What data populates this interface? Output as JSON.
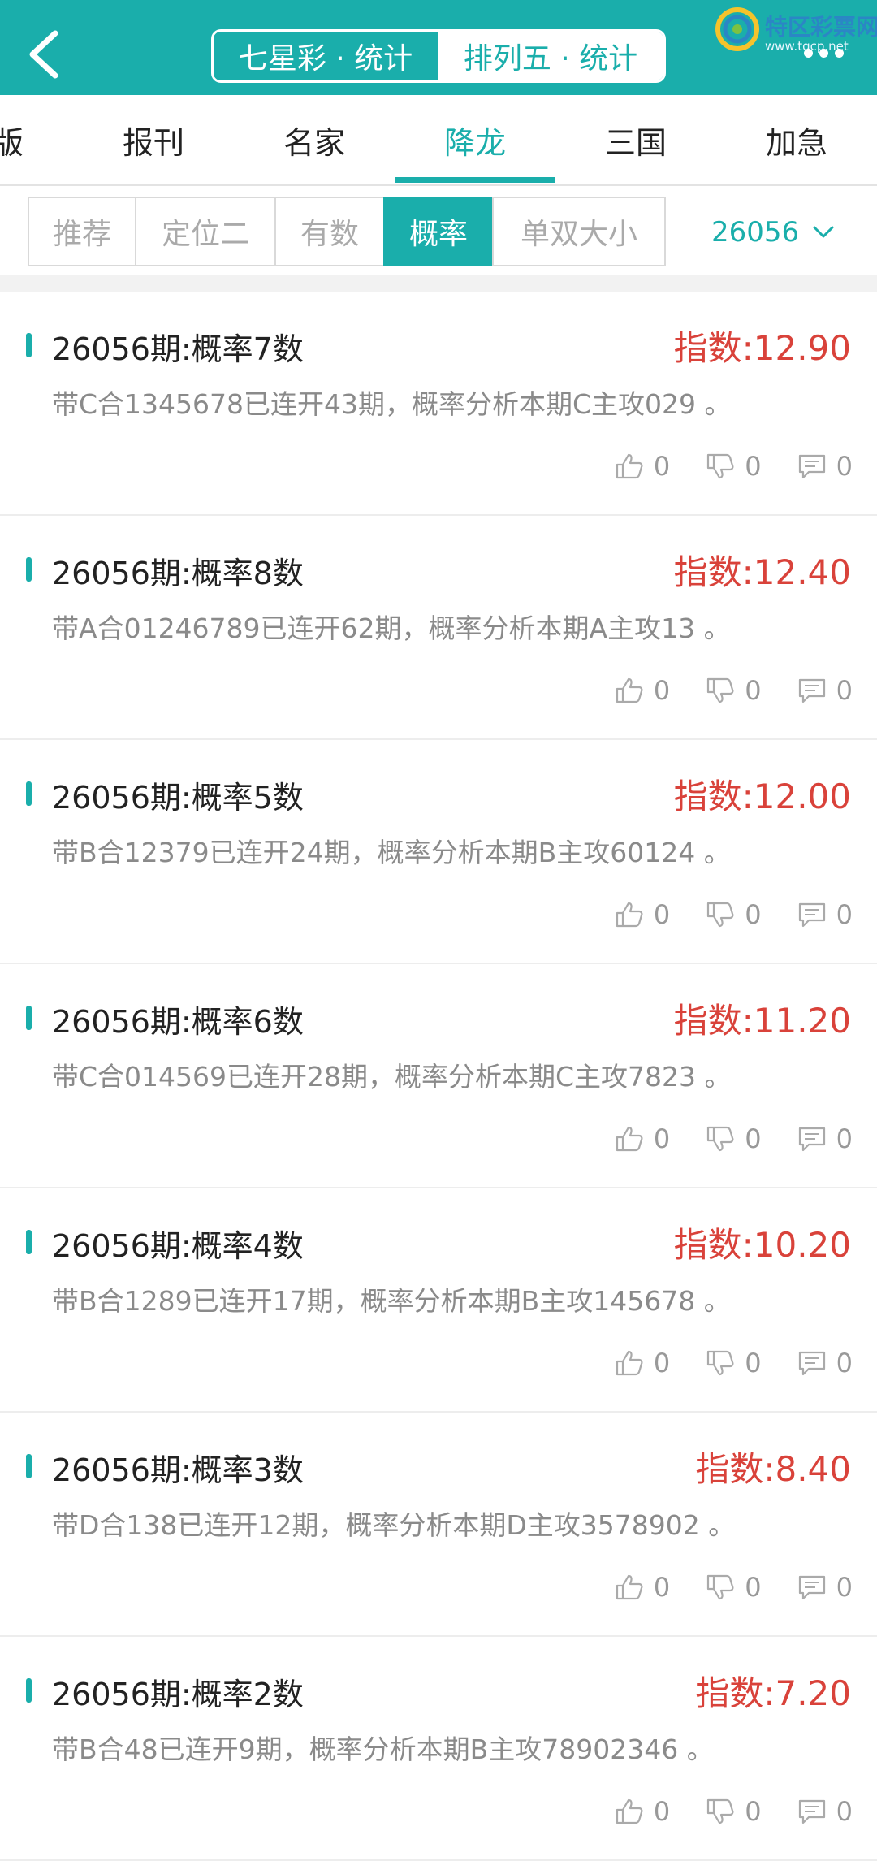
{
  "header": {
    "tab_left": "七星彩 · 统计",
    "tab_right": "排列五 · 统计",
    "logo_name": "特区彩票网",
    "logo_url": "www.tqcp.net",
    "accent": "#1aaeab"
  },
  "categories": [
    "版",
    "报刊",
    "名家",
    "降龙",
    "三国",
    "加急"
  ],
  "active_category": "降龙",
  "filters": [
    "推荐",
    "定位二",
    "有数",
    "概率",
    "单双大小"
  ],
  "active_filter": "概率",
  "issue": "26056",
  "items": [
    {
      "title": "26056期:概率7数",
      "score": "指数:12.90",
      "desc": "带C合1345678已连开43期，概率分析本期C主攻029 。",
      "likes": "0",
      "dislikes": "0",
      "comments": "0"
    },
    {
      "title": "26056期:概率8数",
      "score": "指数:12.40",
      "desc": "带A合01246789已连开62期，概率分析本期A主攻13 。",
      "likes": "0",
      "dislikes": "0",
      "comments": "0"
    },
    {
      "title": "26056期:概率5数",
      "score": "指数:12.00",
      "desc": "带B合12379已连开24期，概率分析本期B主攻60124 。",
      "likes": "0",
      "dislikes": "0",
      "comments": "0"
    },
    {
      "title": "26056期:概率6数",
      "score": "指数:11.20",
      "desc": "带C合014569已连开28期，概率分析本期C主攻7823 。",
      "likes": "0",
      "dislikes": "0",
      "comments": "0"
    },
    {
      "title": "26056期:概率4数",
      "score": "指数:10.20",
      "desc": "带B合1289已连开17期，概率分析本期B主攻145678 。",
      "likes": "0",
      "dislikes": "0",
      "comments": "0"
    },
    {
      "title": "26056期:概率3数",
      "score": "指数:8.40",
      "desc": "带D合138已连开12期，概率分析本期D主攻3578902 。",
      "likes": "0",
      "dislikes": "0",
      "comments": "0"
    },
    {
      "title": "26056期:概率2数",
      "score": "指数:7.20",
      "desc": "带B合48已连开9期，概率分析本期B主攻78902346 。",
      "likes": "0",
      "dislikes": "0",
      "comments": "0"
    }
  ]
}
